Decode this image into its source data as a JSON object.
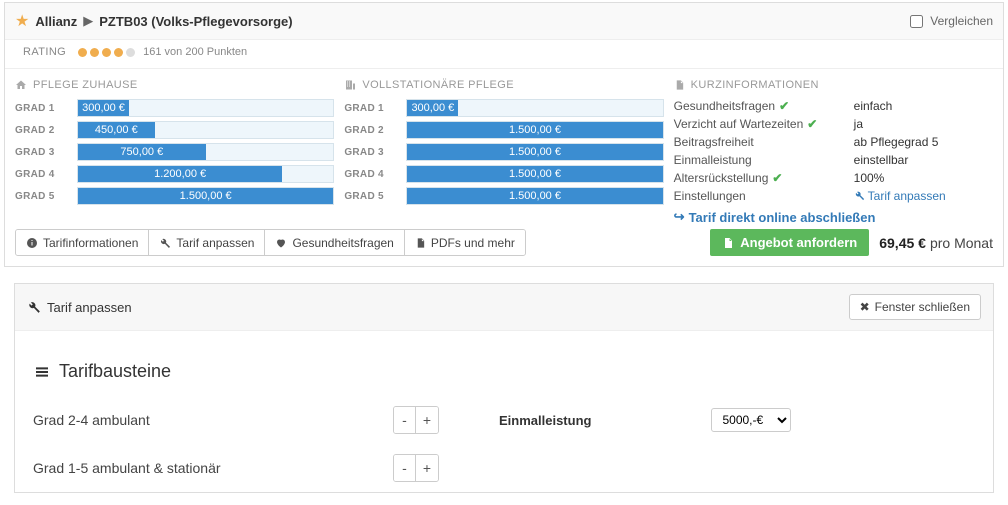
{
  "header": {
    "insurer": "Allianz",
    "plan": "PZTB03 (Volks-Pflegevorsorge)",
    "compare_label": "Vergleichen"
  },
  "rating": {
    "label": "RATING",
    "score_text": "161 von 200 Punkten",
    "dots_on": 4,
    "dots_total": 5
  },
  "panels": {
    "home": {
      "title": "PFLEGE ZUHAUSE",
      "bars": [
        {
          "label": "GRAD 1",
          "value": "300,00 €",
          "pct": 20
        },
        {
          "label": "GRAD 2",
          "value": "450,00 €",
          "pct": 30
        },
        {
          "label": "GRAD 3",
          "value": "750,00 €",
          "pct": 50
        },
        {
          "label": "GRAD 4",
          "value": "1.200,00 €",
          "pct": 80
        },
        {
          "label": "GRAD 5",
          "value": "1.500,00 €",
          "pct": 100
        }
      ]
    },
    "stationary": {
      "title": "VOLLSTATIONÄRE PFLEGE",
      "bars": [
        {
          "label": "GRAD 1",
          "value": "300,00 €",
          "pct": 20
        },
        {
          "label": "GRAD 2",
          "value": "1.500,00 €",
          "pct": 100
        },
        {
          "label": "GRAD 3",
          "value": "1.500,00 €",
          "pct": 100
        },
        {
          "label": "GRAD 4",
          "value": "1.500,00 €",
          "pct": 100
        },
        {
          "label": "GRAD 5",
          "value": "1.500,00 €",
          "pct": 100
        }
      ]
    },
    "info": {
      "title": "KURZINFORMATIONEN",
      "rows": [
        {
          "key": "Gesundheitsfragen",
          "check": true,
          "val": "einfach"
        },
        {
          "key": "Verzicht auf Wartezeiten",
          "check": true,
          "val": "ja"
        },
        {
          "key": "Beitragsfreiheit",
          "check": false,
          "val": "ab Pflegegrad 5"
        },
        {
          "key": "Einmalleistung",
          "check": false,
          "val": "einstellbar"
        },
        {
          "key": "Altersrückstellung",
          "check": true,
          "val": "100%"
        },
        {
          "key": "Einstellungen",
          "check": false,
          "val_link": "Tarif anpassen"
        }
      ],
      "online_link": "Tarif direkt online abschließen"
    }
  },
  "tabs": [
    {
      "icon": "info",
      "label": "Tarifinformationen"
    },
    {
      "icon": "wrench",
      "label": "Tarif anpassen"
    },
    {
      "icon": "heart",
      "label": "Gesundheitsfragen"
    },
    {
      "icon": "file",
      "label": "PDFs und mehr"
    }
  ],
  "cta": {
    "button": "Angebot anfordern",
    "price": "69,45 €",
    "per": "pro Monat"
  },
  "adjust": {
    "title": "Tarif anpassen",
    "close": "Fenster schließen",
    "section": "Tarifbausteine",
    "row1_label": "Grad 2-4 ambulant",
    "row2_label": "Grad 1-5 ambulant & stationär",
    "einmal_label": "Einmalleistung",
    "einmal_value": "5000,-€"
  }
}
